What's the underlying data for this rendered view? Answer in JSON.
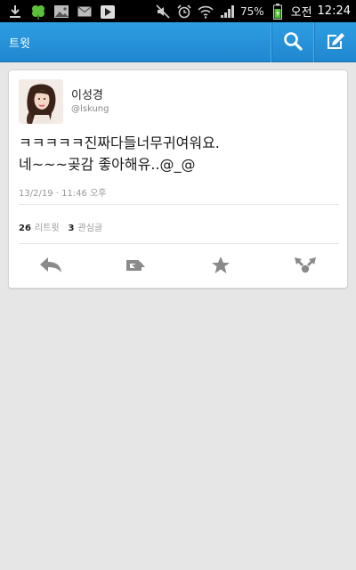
{
  "status_bar": {
    "battery_percent": "75%",
    "ampm": "오전",
    "time": "12:24",
    "left_icons": [
      "download-icon",
      "clover-icon",
      "image-icon",
      "mail-icon",
      "play-store-icon"
    ],
    "right_icons": [
      "mute-icon",
      "alarm-icon",
      "wifi-icon",
      "signal-icon",
      "battery-icon"
    ]
  },
  "app_bar": {
    "title": "트윗",
    "actions": [
      "search-icon",
      "compose-icon"
    ],
    "color": "#2a96dd"
  },
  "tweet": {
    "user_name": "이성경",
    "user_handle": "@lskung",
    "text_lines": [
      "ㅋㅋㅋㅋㅋ진짜다들너무귀여워요.",
      "네~~~곶감 좋아해유..@_@"
    ],
    "timestamp": "13/2/19 · 11:46 오후",
    "retweet_count": "26",
    "retweet_label": "리트윗",
    "favorite_count": "3",
    "favorite_label": "관심글",
    "actions": [
      "reply-icon",
      "retweet-icon",
      "favorite-icon",
      "share-icon"
    ]
  }
}
